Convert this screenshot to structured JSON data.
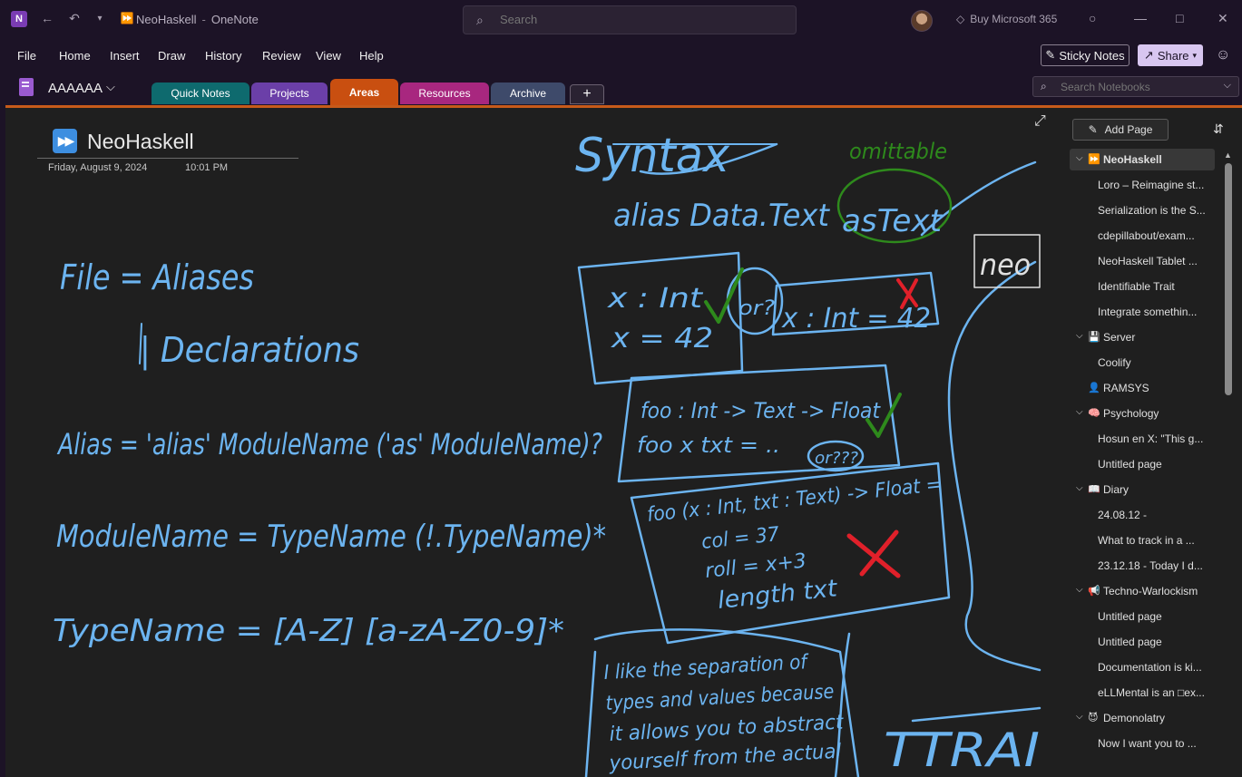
{
  "titlebar": {
    "app_title": "NeoHaskell",
    "app_name": "OneNote",
    "search_placeholder": "Search",
    "buy_label": "Buy Microsoft 365"
  },
  "menu": {
    "items": [
      "File",
      "Home",
      "Insert",
      "Draw",
      "History",
      "Review",
      "View",
      "Help"
    ],
    "sticky_notes": "Sticky Notes",
    "share": "Share"
  },
  "notebook": {
    "name": "AAAAAA",
    "sections": [
      {
        "label": "Quick Notes",
        "color": "#0e6a6e"
      },
      {
        "label": "Projects",
        "color": "#6b3fa8"
      },
      {
        "label": "Areas",
        "color": "#c94f10",
        "active": true
      },
      {
        "label": "Resources",
        "color": "#a8277f"
      },
      {
        "label": "Archive",
        "color": "#3e4a6a"
      }
    ],
    "add_section": "+",
    "search_placeholder": "Search Notebooks"
  },
  "page": {
    "title": "NeoHaskell",
    "date": "Friday, August 9, 2024",
    "time": "10:01 PM"
  },
  "pagelist": {
    "add_page": "Add Page",
    "items": [
      {
        "label": "NeoHaskell",
        "level": 0,
        "icon": "⏩",
        "chevron": true,
        "selected": true
      },
      {
        "label": "Loro – Reimagine st...",
        "level": 1
      },
      {
        "label": "Serialization is the S...",
        "level": 1
      },
      {
        "label": "cdepillabout/exam...",
        "level": 1
      },
      {
        "label": "NeoHaskell Tablet ...",
        "level": 1
      },
      {
        "label": "Identifiable Trait",
        "level": 1
      },
      {
        "label": "Integrate somethin...",
        "level": 1
      },
      {
        "label": "Server",
        "level": 0,
        "icon": "💾",
        "chevron": true
      },
      {
        "label": "Coolify",
        "level": 1
      },
      {
        "label": "RAMSYS",
        "level": 1,
        "icon": "👤"
      },
      {
        "label": "Psychology",
        "level": 0,
        "icon": "🧠",
        "chevron": true
      },
      {
        "label": "Hosun en X: \"This g...",
        "level": 1
      },
      {
        "label": "Untitled page",
        "level": 1
      },
      {
        "label": "Diary",
        "level": 0,
        "icon": "📖",
        "chevron": true
      },
      {
        "label": "24.08.12 -",
        "level": 1
      },
      {
        "label": "What to track in a ...",
        "level": 1
      },
      {
        "label": "23.12.18 - Today I d...",
        "level": 1
      },
      {
        "label": "Techno-Warlockism",
        "level": 0,
        "icon": "📢",
        "chevron": true
      },
      {
        "label": "Untitled page",
        "level": 1
      },
      {
        "label": "Untitled page",
        "level": 1
      },
      {
        "label": "Documentation is ki...",
        "level": 1
      },
      {
        "label": "eLLMental is an □ex...",
        "level": 1
      },
      {
        "label": "Demonolatry",
        "level": 0,
        "icon": "😈",
        "chevron": true
      },
      {
        "label": "Now I want you to ...",
        "level": 1
      }
    ]
  },
  "ink": {
    "blue": "#6cb4f0",
    "green": "#2e8a1c",
    "red": "#e0202a",
    "texts": [
      "Syntax",
      "omittable",
      "alias Data.Text",
      "asText",
      "neo",
      "File = Aliases",
      "| Declarations",
      "Alias = 'alias' ModuleName ('as' ModuleName)?",
      "ModuleName = TypeName (!.TypeName)*",
      "TypeName = [A-Z] [a-zA-Z0-9]*",
      "x : Int",
      "x = 42",
      "or?",
      "x : Int = 42",
      "foo : Int -> Text -> Float",
      "foo x txt = ..",
      "or???",
      "foo (x : Int, txt : Text) -> Float =",
      "col = 37",
      "roll = x+3",
      "length txt",
      "I like the separation of",
      "types and values because",
      "it allows you to abstract",
      "yourself from the actual",
      "TTRAI"
    ]
  }
}
